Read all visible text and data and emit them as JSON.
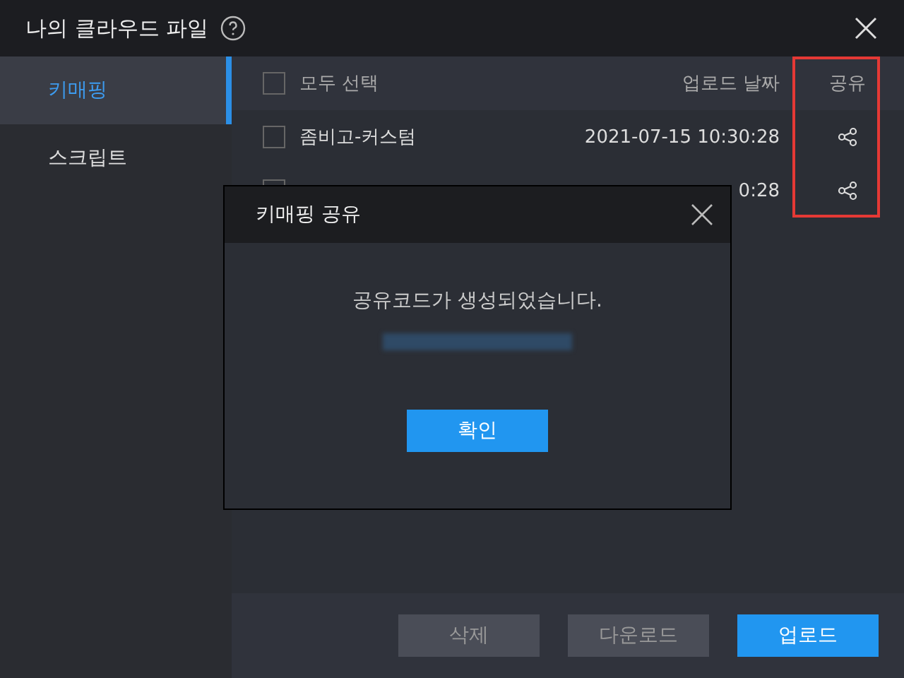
{
  "window": {
    "title": "나의 클라우드 파일"
  },
  "sidebar": {
    "items": [
      {
        "label": "키매핑",
        "selected": true
      },
      {
        "label": "스크립트",
        "selected": false
      }
    ]
  },
  "table": {
    "select_all": {
      "label": "모두 선택",
      "checked": false
    },
    "columns": [
      "업로드 날짜",
      "공유"
    ],
    "rows": [
      {
        "name": "좀비고-커스텀",
        "date": "2021-07-15 10:30:28",
        "checked": false
      },
      {
        "name": "",
        "date": "0:28",
        "checked": false
      }
    ]
  },
  "buttons": [
    {
      "label": "삭제",
      "kind": "secondary"
    },
    {
      "label": "다운로드",
      "kind": "secondary"
    },
    {
      "label": "업로드",
      "kind": "primary"
    }
  ],
  "dialog": {
    "title": "키매핑 공유",
    "message": "공유코드가 생성되었습니다.",
    "button": "확인"
  }
}
